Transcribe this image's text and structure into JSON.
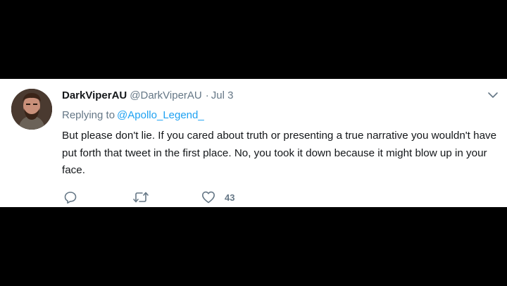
{
  "tweet": {
    "display_name": "DarkViperAU",
    "handle": "@DarkViperAU",
    "separator": "·",
    "date": "Jul 3",
    "replying_to_prefix": "Replying to",
    "replying_to_handle": "@Apollo_Legend_",
    "text": "But please don't lie. If you cared about truth or presenting a true narrative you wouldn't have put forth that tweet in the first place. No, you took it down because it might blow up in your face.",
    "actions": {
      "reply_icon": "reply-icon",
      "retweet_icon": "retweet-icon",
      "like_icon": "heart-icon",
      "like_count": "43"
    }
  },
  "colors": {
    "background": "#000000",
    "card": "#ffffff",
    "link": "#1da1f2",
    "secondary_text": "#657786",
    "primary_text": "#14171a"
  }
}
